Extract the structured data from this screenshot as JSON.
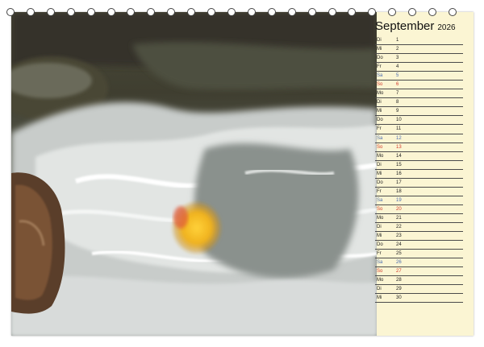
{
  "calendar": {
    "month": "September",
    "year": "2026",
    "binding_hole_count": 23,
    "days": [
      {
        "weekday": "Di",
        "day": "1",
        "type": "weekday"
      },
      {
        "weekday": "Mi",
        "day": "2",
        "type": "weekday"
      },
      {
        "weekday": "Do",
        "day": "3",
        "type": "weekday"
      },
      {
        "weekday": "Fr",
        "day": "4",
        "type": "weekday"
      },
      {
        "weekday": "Sa",
        "day": "5",
        "type": "saturday"
      },
      {
        "weekday": "So",
        "day": "6",
        "type": "sunday"
      },
      {
        "weekday": "Mo",
        "day": "7",
        "type": "weekday"
      },
      {
        "weekday": "Di",
        "day": "8",
        "type": "weekday"
      },
      {
        "weekday": "Mi",
        "day": "9",
        "type": "weekday"
      },
      {
        "weekday": "Do",
        "day": "10",
        "type": "weekday"
      },
      {
        "weekday": "Fr",
        "day": "11",
        "type": "weekday"
      },
      {
        "weekday": "Sa",
        "day": "12",
        "type": "saturday"
      },
      {
        "weekday": "So",
        "day": "13",
        "type": "sunday"
      },
      {
        "weekday": "Mo",
        "day": "14",
        "type": "weekday"
      },
      {
        "weekday": "Di",
        "day": "15",
        "type": "weekday"
      },
      {
        "weekday": "Mi",
        "day": "16",
        "type": "weekday"
      },
      {
        "weekday": "Do",
        "day": "17",
        "type": "weekday"
      },
      {
        "weekday": "Fr",
        "day": "18",
        "type": "weekday"
      },
      {
        "weekday": "Sa",
        "day": "19",
        "type": "saturday"
      },
      {
        "weekday": "So",
        "day": "20",
        "type": "sunday"
      },
      {
        "weekday": "Mo",
        "day": "21",
        "type": "weekday"
      },
      {
        "weekday": "Di",
        "day": "22",
        "type": "weekday"
      },
      {
        "weekday": "Mi",
        "day": "23",
        "type": "weekday"
      },
      {
        "weekday": "Do",
        "day": "24",
        "type": "weekday"
      },
      {
        "weekday": "Fr",
        "day": "25",
        "type": "weekday"
      },
      {
        "weekday": "Sa",
        "day": "26",
        "type": "saturday"
      },
      {
        "weekday": "So",
        "day": "27",
        "type": "sunday"
      },
      {
        "weekday": "Mo",
        "day": "28",
        "type": "weekday"
      },
      {
        "weekday": "Di",
        "day": "29",
        "type": "weekday"
      },
      {
        "weekday": "Mi",
        "day": "30",
        "type": "weekday"
      }
    ]
  },
  "colors": {
    "panel": "#fbf5d3",
    "saturday": "#4b6db0",
    "sunday": "#d23b2c",
    "rule": "#4a4a4a"
  },
  "photo": {
    "subject": "yellow-rubber-duck-in-rushing-stream"
  }
}
